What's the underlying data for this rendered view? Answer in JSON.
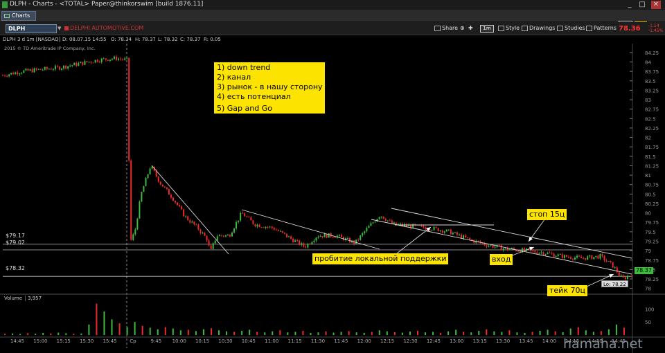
{
  "window": {
    "title": "DLPH - Charts - <TOTAL> Paper@thinkorswim [build 1876.11]",
    "controls": [
      "_",
      "□",
      "✕"
    ]
  },
  "tabs": [
    {
      "label": "Charts"
    }
  ],
  "quote": {
    "bar_fill_percent": 80
  },
  "toolbar": {
    "symbol": "DLPH",
    "company": "DELPHI AUTOMOTIVE.COM",
    "share": "Share",
    "interval": "1m",
    "style": "Style",
    "drawings": "Drawings",
    "studies": "Studies",
    "patterns": "Patterns",
    "last_price": "78.36",
    "change_lines": [
      "-1.14",
      "-1.45%"
    ]
  },
  "chart_head": {
    "symbol_desc": "DLPH 3 d 1m [NASDAQ]",
    "date": "D: 08.07.15 14:55",
    "open": "O: 78.34",
    "high": "H: 78.37",
    "low": "L: 78.32",
    "close": "C: 78.37",
    "range": "R: 0.05",
    "copyright": "2015 © TD Ameritrade IP Company, Inc."
  },
  "annotation": {
    "lines": [
      "1) down trend",
      "2) канал",
      "3) рынок - в нашу сторону",
      "4) есть потенциал",
      "5) Gap and Go"
    ]
  },
  "labels": {
    "breakdown": "пробитие локальной поддержки",
    "stop": "стоп 15ц",
    "entry": "вход",
    "take": "тейк 70ц",
    "low_marker": "Lo: 78.22",
    "current_price": "78.37"
  },
  "levels": [
    {
      "label": "$79.17",
      "value": 79.17
    },
    {
      "label": "$79.02",
      "value": 79.02
    },
    {
      "label": "$78.32",
      "value": 78.32
    }
  ],
  "volume": {
    "label": "Volume",
    "value": "3,957"
  },
  "watermark": "hamaha.net",
  "chart_data": {
    "type": "candlestick",
    "y_ticks": [
      "84.25",
      "84",
      "83.75",
      "83.5",
      "83.25",
      "83",
      "82.75",
      "82.5",
      "82.25",
      "82",
      "81.75",
      "81.5",
      "81.25",
      "81",
      "80.75",
      "80.5",
      "80.25",
      "80",
      "79.75",
      "79.5",
      "79.25",
      "79",
      "78.75",
      "78.5",
      "78.25",
      "78"
    ],
    "ylim": [
      77.92,
      84.45
    ],
    "x_ticks": [
      "14:45",
      "15:00",
      "15:15",
      "15:30",
      "15:45",
      "Cp",
      "9:45",
      "10:00",
      "10:15",
      "10:30",
      "10:45",
      "11:00",
      "11:15",
      "11:30",
      "11:45",
      "12:00",
      "12:15",
      "12:30",
      "12:45",
      "13:00",
      "13:15",
      "13:30",
      "13:45",
      "14:00",
      "14:15",
      "14:30",
      "14:45"
    ],
    "volume_ticks": [
      "100",
      "50"
    ],
    "price_path": [
      [
        0,
        83.65
      ],
      [
        0.03,
        83.75
      ],
      [
        0.06,
        83.8
      ],
      [
        0.09,
        83.85
      ],
      [
        0.12,
        83.95
      ],
      [
        0.15,
        84.05
      ],
      [
        0.18,
        84.1
      ],
      [
        0.198,
        84.05
      ],
      [
        0.2,
        82.5
      ],
      [
        0.202,
        79.2
      ],
      [
        0.21,
        79.5
      ],
      [
        0.22,
        80.5
      ],
      [
        0.235,
        81.25
      ],
      [
        0.25,
        80.8
      ],
      [
        0.27,
        80.4
      ],
      [
        0.29,
        79.9
      ],
      [
        0.31,
        79.6
      ],
      [
        0.325,
        79.3
      ],
      [
        0.33,
        78.95
      ],
      [
        0.34,
        79.4
      ],
      [
        0.36,
        79.4
      ],
      [
        0.38,
        80.0
      ],
      [
        0.4,
        79.7
      ],
      [
        0.43,
        79.6
      ],
      [
        0.46,
        79.3
      ],
      [
        0.48,
        79.1
      ],
      [
        0.5,
        79.4
      ],
      [
        0.53,
        79.4
      ],
      [
        0.56,
        79.2
      ],
      [
        0.58,
        79.6
      ],
      [
        0.6,
        79.95
      ],
      [
        0.62,
        79.7
      ],
      [
        0.65,
        79.65
      ],
      [
        0.68,
        79.6
      ],
      [
        0.71,
        79.5
      ],
      [
        0.74,
        79.3
      ],
      [
        0.77,
        79.15
      ],
      [
        0.8,
        79.05
      ],
      [
        0.83,
        79.0
      ],
      [
        0.86,
        78.95
      ],
      [
        0.89,
        78.85
      ],
      [
        0.92,
        78.8
      ],
      [
        0.95,
        78.85
      ],
      [
        0.97,
        78.6
      ],
      [
        0.985,
        78.25
      ],
      [
        1.0,
        78.37
      ]
    ],
    "volume_series": [
      5,
      6,
      4,
      7,
      5,
      8,
      6,
      9,
      7,
      5,
      6,
      40,
      120,
      90,
      60,
      45,
      30,
      50,
      35,
      28,
      22,
      30,
      25,
      18,
      20,
      15,
      22,
      26,
      18,
      14,
      12,
      16,
      20,
      12,
      10,
      14,
      18,
      10,
      12,
      16,
      8,
      10,
      14,
      9,
      12,
      15,
      10,
      8,
      12,
      18,
      14,
      11,
      9,
      13,
      16,
      10,
      12,
      8,
      14,
      20,
      12,
      10,
      16,
      22,
      14,
      12,
      18,
      10,
      8,
      12,
      16,
      20,
      14,
      11,
      25,
      30,
      18,
      12,
      15,
      22,
      40,
      28
    ]
  }
}
